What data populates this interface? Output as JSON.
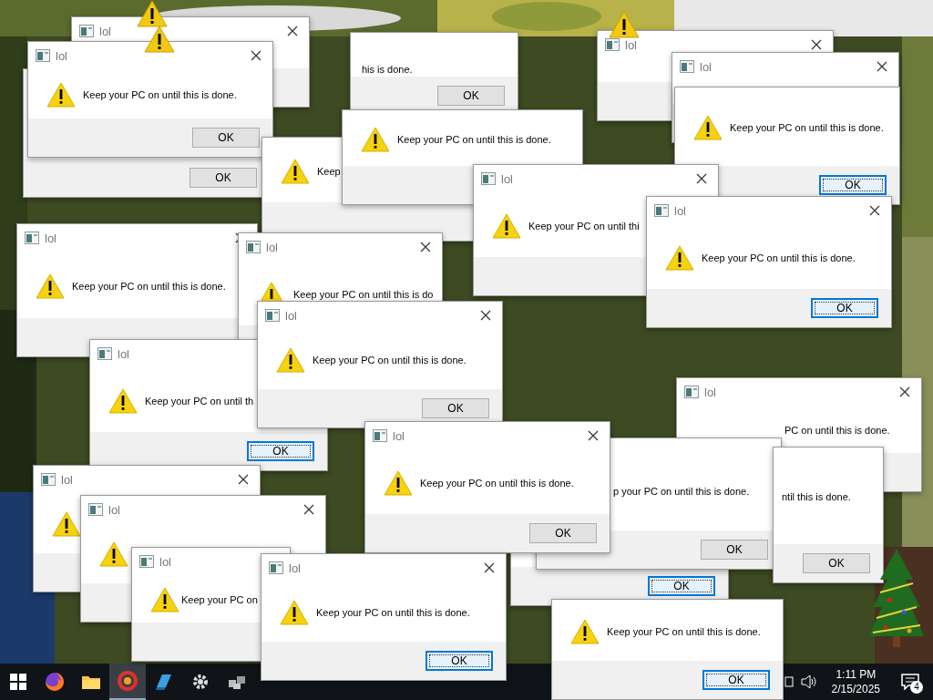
{
  "dialogs": [
    {
      "title": "lol"
    },
    {
      "title": "lol"
    },
    {
      "title": "lol"
    },
    {
      "title": "lol",
      "warning_icon": true,
      "message": "Keep your PC on until this is done.",
      "button": {
        "label": "OK",
        "focused": false
      }
    },
    {
      "button": {
        "label": "OK",
        "focused": false
      }
    },
    {
      "message": "his is done.",
      "button": {
        "label": "OK",
        "focused": false
      }
    },
    {
      "warning_icon": true,
      "message": "Keep"
    },
    {
      "warning_icon": true,
      "message": "Keep your PC on until this is done."
    },
    {
      "warning_icon": true,
      "message": "Keep your PC on until this is done.",
      "button": {
        "label": "OK",
        "focused": true
      }
    },
    {
      "title": "lol",
      "warning_icon": true,
      "message": "Keep your PC on until this is done."
    },
    {
      "title": "lol",
      "warning_icon": true,
      "message": "Keep your PC on until thi"
    },
    {
      "title": "lol",
      "warning_icon": true,
      "message": "Keep your PC on until this is done.",
      "button": {
        "label": "OK",
        "focused": true
      }
    },
    {
      "title": "lol",
      "warning_icon": true,
      "message": "Keep your PC on until this is do"
    },
    {
      "title": "lol",
      "warning_icon": true,
      "message": "Keep your PC on until th",
      "button": {
        "label": "OK",
        "focused": true
      }
    },
    {
      "title": "lol",
      "warning_icon": true,
      "message": "Keep your PC on until this is done.",
      "button": {
        "label": "OK",
        "focused": false
      }
    },
    {
      "title": "lol",
      "warning_icon": true
    },
    {
      "title": "lol",
      "warning_icon": true
    },
    {
      "button": {
        "label": "OK",
        "focused": true
      }
    },
    {
      "title": "lol",
      "message": "PC on until this is done."
    },
    {
      "message": "p your PC on until this is done.",
      "button": {
        "label": "OK",
        "focused": false
      }
    },
    {
      "title": "lol",
      "warning_icon": true,
      "message": "Keep your PC on until this is done.",
      "button": {
        "label": "OK",
        "focused": false
      }
    },
    {
      "message": "ntil this is done.",
      "button": {
        "label": "OK",
        "focused": false
      }
    },
    {
      "title": "lol",
      "warning_icon": true,
      "message": "Keep your PC on"
    },
    {
      "title": "lol",
      "warning_icon": true,
      "message": "Keep your PC on until this is done.",
      "button": {
        "label": "OK",
        "focused": true
      }
    },
    {
      "warning_icon": true,
      "message": "Keep your PC on until this is done.",
      "button": {
        "label": "OK",
        "focused": true
      }
    }
  ],
  "taskbar": {
    "apps": [
      {
        "kind": "start",
        "selected": false
      },
      {
        "kind": "browser",
        "selected": false
      },
      {
        "kind": "folder",
        "selected": false
      },
      {
        "kind": "ring",
        "selected": true
      },
      {
        "kind": "blue",
        "selected": false
      },
      {
        "kind": "gear",
        "selected": false
      },
      {
        "kind": "blocks",
        "selected": false
      }
    ]
  },
  "tray": {
    "time": "1:11 PM",
    "date": "2/15/2025",
    "notifications": "4"
  }
}
